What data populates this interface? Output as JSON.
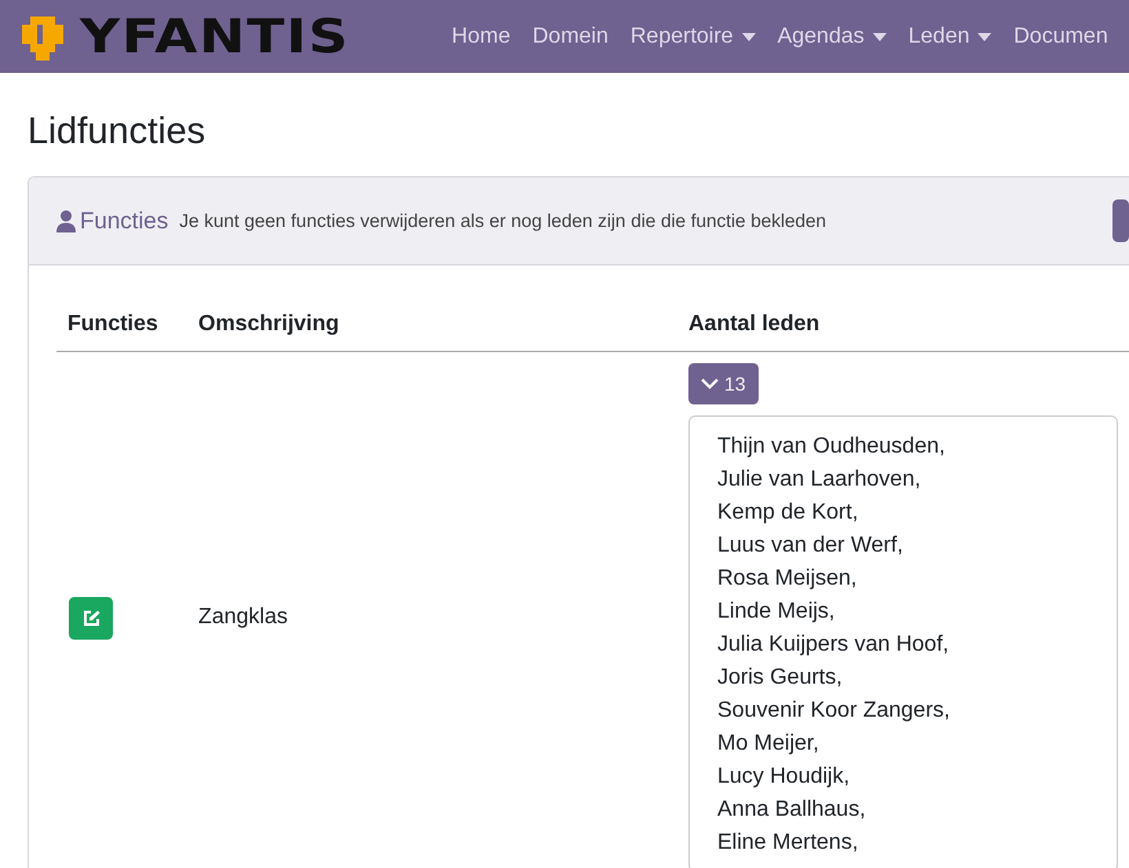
{
  "navbar": {
    "logo": "YFANTIS",
    "items": [
      {
        "label": "Home",
        "dropdown": false
      },
      {
        "label": "Domein",
        "dropdown": false
      },
      {
        "label": "Repertoire",
        "dropdown": true
      },
      {
        "label": "Agendas",
        "dropdown": true
      },
      {
        "label": "Leden",
        "dropdown": true
      },
      {
        "label": "Documen",
        "dropdown": false
      }
    ]
  },
  "page_title": "Lidfuncties",
  "card": {
    "title": "Functies",
    "note": "Je kunt geen functies verwijderen als er nog leden zijn die die functie bekleden"
  },
  "table": {
    "columns": [
      "Functies",
      "Omschrijving",
      "Aantal leden"
    ],
    "rows": [
      {
        "description": "Zangklas",
        "count": "13",
        "expanded": true,
        "members": [
          "Thijn van Oudheusden,",
          "Julie van Laarhoven,",
          "Kemp de Kort,",
          "Luus van der Werf,",
          "Rosa Meijsen,",
          "Linde Meijs,",
          "Julia Kuijpers van Hoof,",
          "Joris Geurts,",
          "Souvenir Koor Zangers,",
          "Mo Meijer,",
          "Lucy Houdijk,",
          "Anna Ballhaus,",
          "Eline Mertens,"
        ]
      }
    ]
  }
}
